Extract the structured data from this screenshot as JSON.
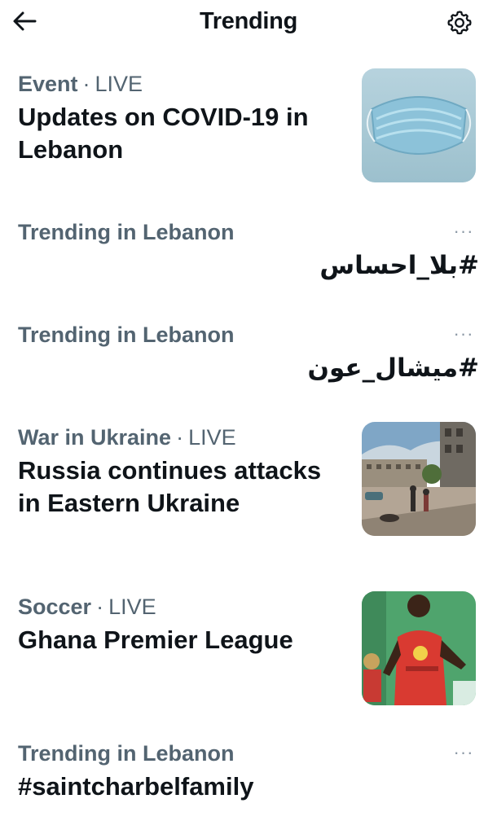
{
  "header": {
    "title": "Trending"
  },
  "trends": [
    {
      "category": "Event",
      "live": "LIVE",
      "headline": "Updates on COVID-19 in Lebanon",
      "thumb": "surgical-mask-photo"
    },
    {
      "category": "Trending in Lebanon",
      "headline": "#بلا_احساس"
    },
    {
      "category": "Trending in Lebanon",
      "headline": "#ميشال_عون"
    },
    {
      "category": "War in Ukraine",
      "live": "LIVE",
      "headline": "Russia continues attacks in Eastern Ukraine",
      "thumb": "war-street-photo"
    },
    {
      "category": "Soccer",
      "live": "LIVE",
      "headline": "Ghana Premier League",
      "thumb": "soccer-player-photo"
    },
    {
      "category": "Trending in Lebanon",
      "headline": "#saintcharbelfamily"
    }
  ],
  "separator": "·",
  "more_label": "···",
  "colors": {
    "text": "#0f1419",
    "secondary": "#536471",
    "more": "#8b98a5"
  }
}
